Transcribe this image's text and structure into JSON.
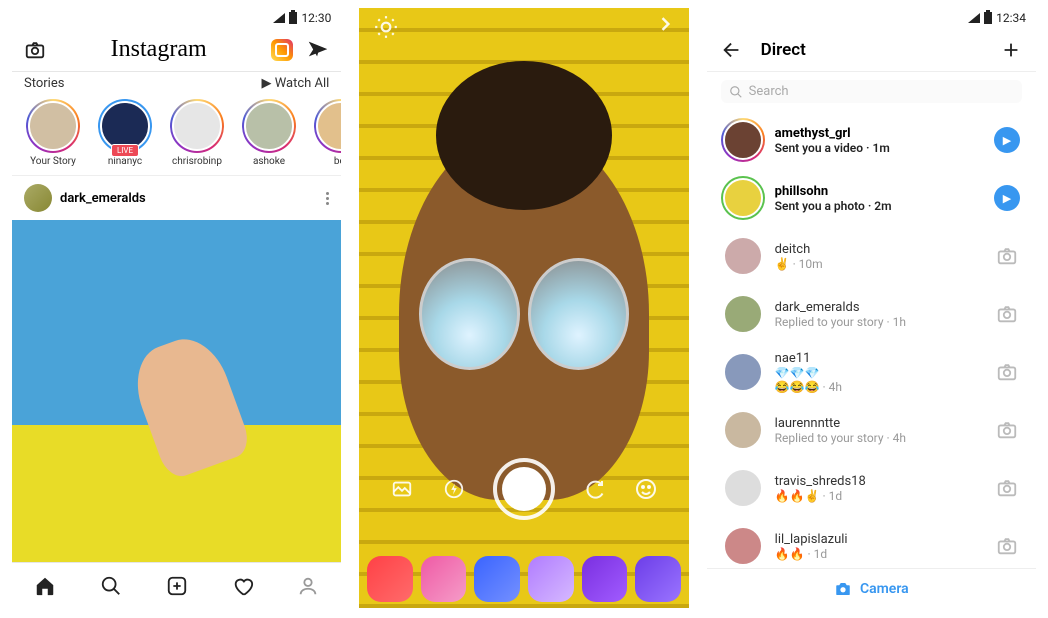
{
  "feed": {
    "statusbar": {
      "time": "12:30"
    },
    "appTitle": "Instagram",
    "storiesLabel": "Stories",
    "watchAllLabel": "Watch All",
    "stories": [
      {
        "name": "Your Story",
        "ring": "ring-grad",
        "live": false,
        "bg": "#d1bfa3"
      },
      {
        "name": "ninanyc",
        "ring": "ring-blue",
        "live": true,
        "liveLabel": "LIVE",
        "bg": "#1b2a55"
      },
      {
        "name": "chrisrobinp",
        "ring": "ring-grad",
        "live": false,
        "bg": "#e6e6e6"
      },
      {
        "name": "ashoke",
        "ring": "ring-grad",
        "live": false,
        "bg": "#b8c0a8"
      },
      {
        "name": "ber",
        "ring": "ring-grad",
        "live": false,
        "bg": "#e2c08c"
      }
    ],
    "post": {
      "username": "dark_emeralds"
    }
  },
  "camera": {
    "filters": [
      {
        "bg": "linear-gradient(135deg,#ff4146,#ff6b6b)"
      },
      {
        "bg": "linear-gradient(135deg,#ef5aa5,#f59cc8)"
      },
      {
        "bg": "linear-gradient(135deg,#3a64ff,#7490ff)"
      },
      {
        "bg": "linear-gradient(135deg,#b07cff,#d6b9ff)"
      },
      {
        "bg": "linear-gradient(135deg,#7a2fe0,#a15cff)"
      },
      {
        "bg": "linear-gradient(135deg,#6c3de8,#9a74ff)"
      }
    ]
  },
  "direct": {
    "statusbar": {
      "time": "12:34"
    },
    "title": "Direct",
    "searchPlaceholder": "Search",
    "cameraLabel": "Camera",
    "items": [
      {
        "name": "amethyst_grl",
        "msg": "Sent you a video",
        "time": "1m",
        "bold": true,
        "ring": "ring-grad",
        "avatar": "#6b4233",
        "action": "play"
      },
      {
        "name": "phillsohn",
        "msg": "Sent you a photo",
        "time": "2m",
        "bold": true,
        "ring": "ring-green",
        "avatar": "#e8d13f",
        "action": "play"
      },
      {
        "name": "deitch",
        "msg": "✌️",
        "time": "10m",
        "bold": false,
        "ring": "",
        "avatar": "#caa",
        "action": "camera"
      },
      {
        "name": "dark_emeralds",
        "msg": "Replied to your story",
        "time": "1h",
        "bold": false,
        "ring": "",
        "avatar": "#9a7",
        "action": "camera"
      },
      {
        "name": "nae11",
        "msg": "💎💎💎",
        "time": "4h",
        "msg2": "😂😂😂",
        "bold": false,
        "ring": "",
        "avatar": "#89b",
        "action": "camera"
      },
      {
        "name": "laurennntte",
        "msg": "Replied to your story",
        "time": "4h",
        "bold": false,
        "ring": "",
        "avatar": "#c9b8a0",
        "action": "camera"
      },
      {
        "name": "travis_shreds18",
        "msg": "🔥🔥✌️",
        "time": "1d",
        "bold": false,
        "ring": "",
        "avatar": "#ddd",
        "action": "camera"
      },
      {
        "name": "lil_lapislazuli",
        "msg": "🔥🔥",
        "time": "1d",
        "bold": false,
        "ring": "",
        "avatar": "#c88",
        "action": "camera"
      }
    ]
  }
}
